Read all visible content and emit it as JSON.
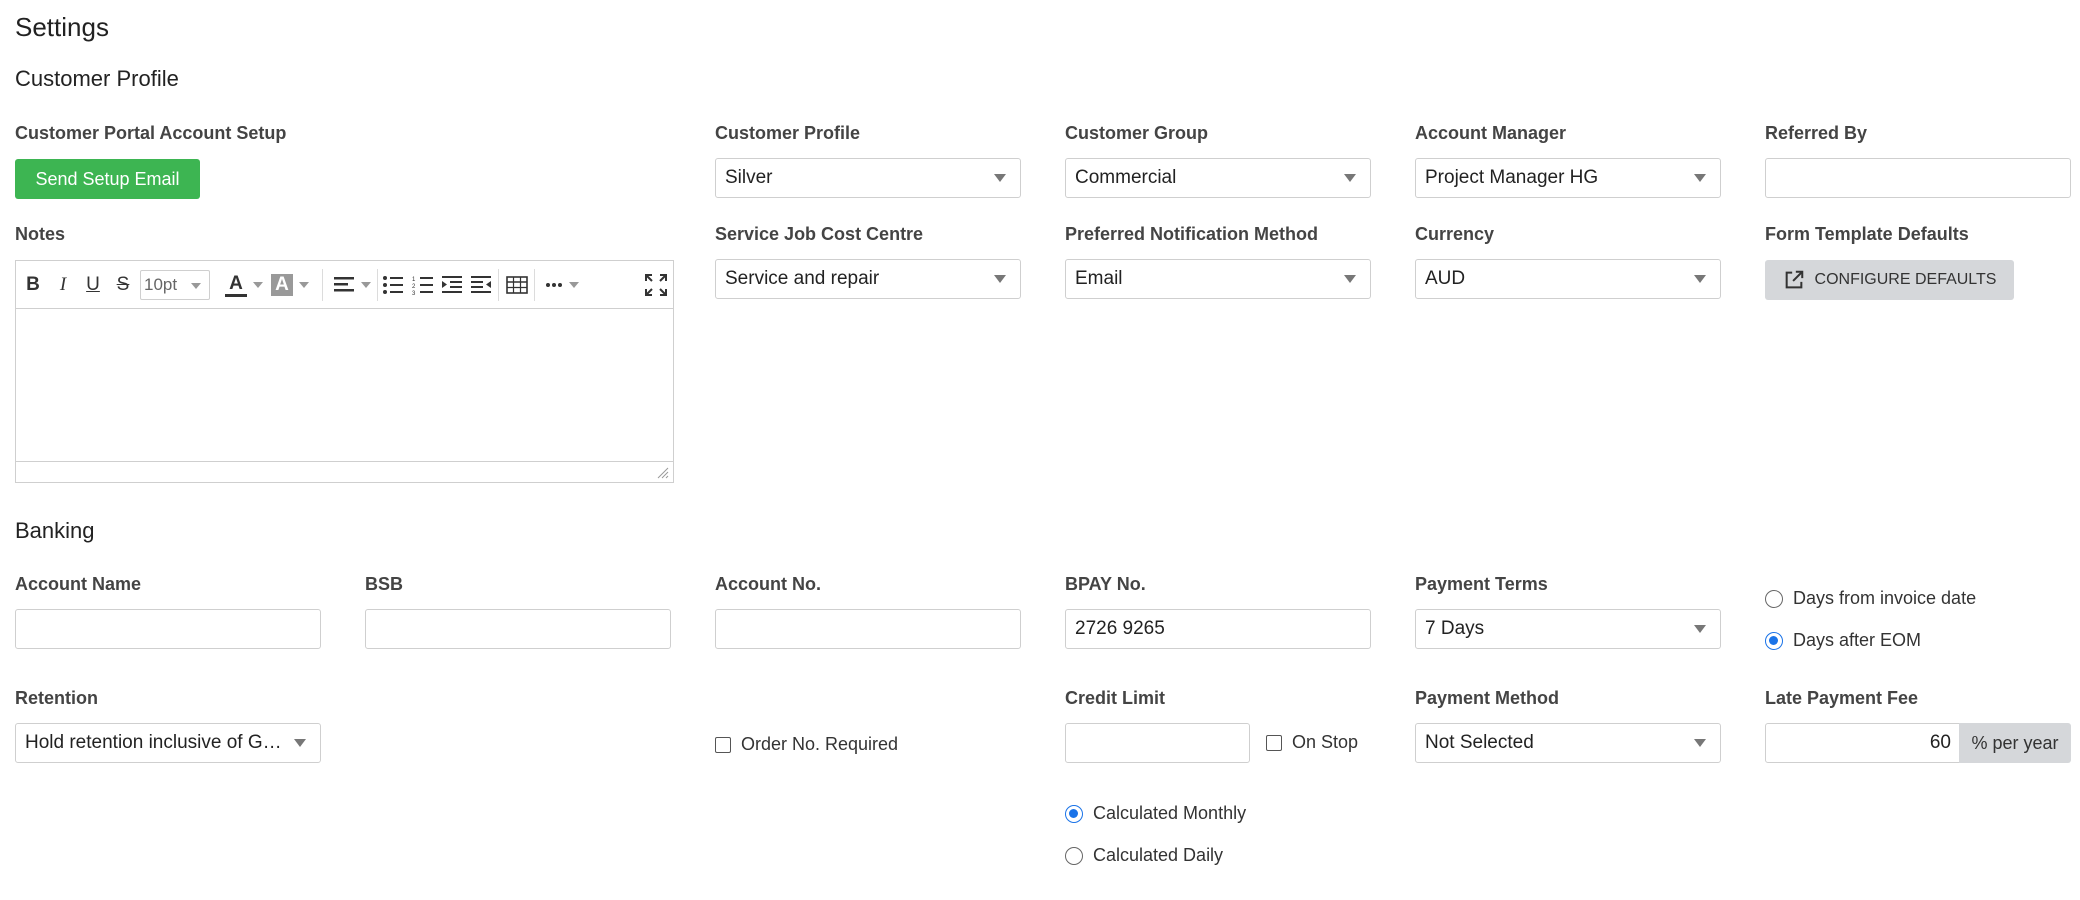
{
  "page": {
    "title": "Settings"
  },
  "customer_profile": {
    "section_title": "Customer Profile",
    "portal": {
      "label": "Customer Portal Account Setup",
      "button": "Send Setup Email"
    },
    "profile": {
      "label": "Customer Profile",
      "value": "Silver"
    },
    "group": {
      "label": "Customer Group",
      "value": "Commercial"
    },
    "account_manager": {
      "label": "Account Manager",
      "value": "Project Manager HG"
    },
    "referred_by": {
      "label": "Referred By",
      "value": ""
    },
    "notes": {
      "label": "Notes",
      "font_size": "10pt"
    },
    "cost_centre": {
      "label": "Service Job Cost Centre",
      "value": "Service and repair"
    },
    "notification": {
      "label": "Preferred Notification Method",
      "value": "Email"
    },
    "currency": {
      "label": "Currency",
      "value": "AUD"
    },
    "form_template": {
      "label": "Form Template Defaults",
      "button": "CONFIGURE DEFAULTS"
    }
  },
  "banking": {
    "section_title": "Banking",
    "account_name": {
      "label": "Account Name",
      "value": ""
    },
    "bsb": {
      "label": "BSB",
      "value": ""
    },
    "account_no": {
      "label": "Account No.",
      "value": ""
    },
    "bpay_no": {
      "label": "BPAY No.",
      "value": "2726 9265"
    },
    "payment_terms": {
      "label": "Payment Terms",
      "value": "7 Days"
    },
    "terms_basis": {
      "options": [
        "Days from invoice date",
        "Days after EOM"
      ],
      "selected": "Days after EOM"
    },
    "retention": {
      "label": "Retention",
      "value": "Hold retention inclusive of G…"
    },
    "order_no_required": {
      "label": "Order No. Required",
      "checked": false
    },
    "credit_limit": {
      "label": "Credit Limit",
      "value": ""
    },
    "on_stop": {
      "label": "On Stop",
      "checked": false
    },
    "payment_method": {
      "label": "Payment Method",
      "value": "Not Selected"
    },
    "late_fee": {
      "label": "Late Payment Fee",
      "value": "60",
      "unit": "% per year"
    },
    "calculation": {
      "options": [
        "Calculated Monthly",
        "Calculated Daily"
      ],
      "selected": "Calculated Monthly"
    }
  },
  "colors": {
    "primary_green": "#3db552",
    "radio_blue": "#1a73e8",
    "button_grey": "#d5d7da"
  }
}
